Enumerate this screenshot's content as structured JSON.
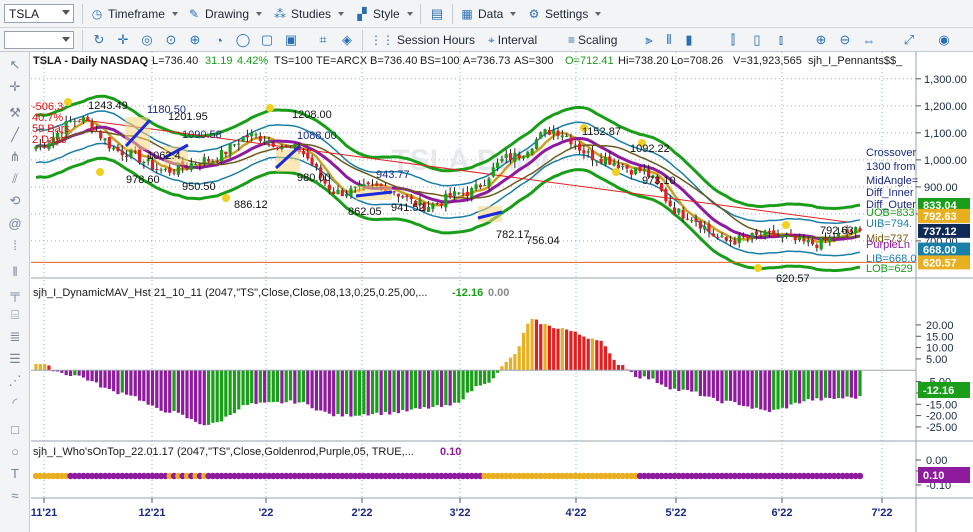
{
  "toolbar": {
    "symbol": "TSLA",
    "timeframe": "Timeframe",
    "drawing": "Drawing",
    "studies": "Studies",
    "style": "Style",
    "data": "Data",
    "settings": "Settings",
    "session_hours": "Session Hours",
    "interval": "Interval",
    "scaling": "Scaling"
  },
  "icons": {
    "timeframe": "clock-icon",
    "drawing": "pencil-icon",
    "studies": "studies-icon",
    "style": "style-icon",
    "data": "data-icon",
    "settings": "gear-icon"
  },
  "price_header": {
    "title": "TSLA - Daily  NASDAQ",
    "L": "L=736.40",
    "chg": "31.19",
    "pct": "4.42%",
    "ts": "TS=100",
    "te": "TE=ARCX",
    "B": "B=736.40",
    "BS": "BS=100",
    "A": "A=736.73",
    "AS": "AS=300",
    "O": "O=712.41",
    "Hi": "Hi=738.20",
    "Lo": "Lo=708.26",
    "V": "V=31,923,565",
    "study": "sjh_I_Pennants$$_"
  },
  "watermark": "TSLA Daily",
  "price_annotations": [
    {
      "text": "-506.3",
      "color": "#e01010"
    },
    {
      "text": "40.7%",
      "color": "#e01010"
    },
    {
      "text": "59 Bars",
      "color": "#e01010"
    },
    {
      "text": "2 Days",
      "color": "#e01010"
    },
    {
      "text": "1243.49",
      "color": "#111111"
    },
    {
      "text": "1180.50",
      "color": "#111111"
    },
    {
      "text": "1201.95",
      "color": "#111111"
    },
    {
      "text": "1090.58",
      "color": "#111111"
    },
    {
      "text": "1062.4",
      "color": "#111111"
    },
    {
      "text": "978.60",
      "color": "#111111"
    },
    {
      "text": "950.50",
      "color": "#111111"
    },
    {
      "text": "886.12",
      "color": "#111111"
    },
    {
      "text": "1208.00",
      "color": "#111111"
    },
    {
      "text": "1088.00",
      "color": "#111111"
    },
    {
      "text": "980.00",
      "color": "#111111"
    },
    {
      "text": "943.77",
      "color": "#111111"
    },
    {
      "text": "862.05",
      "color": "#111111"
    },
    {
      "text": "941.52",
      "color": "#111111"
    },
    {
      "text": "756.04",
      "color": "#111111"
    },
    {
      "text": "782.17",
      "color": "#111111"
    },
    {
      "text": "1152.87",
      "color": "#111111"
    },
    {
      "text": "1092.22",
      "color": "#111111"
    },
    {
      "text": "973.10",
      "color": "#111111"
    },
    {
      "text": "792.63",
      "color": "#111111"
    },
    {
      "text": "620.57",
      "color": "#111111"
    }
  ],
  "side_note": [
    "Crossover",
    "1300 from",
    "MidAngle=",
    "Diff_Inner",
    "Diff_Outer"
  ],
  "band_labels": [
    {
      "text": "UOB=833",
      "color": "#1a9e1a"
    },
    {
      "text": "UIB=794.",
      "color": "#1a7fa8"
    },
    {
      "text": "Mid=737",
      "color": "#7a5a10"
    },
    {
      "text": "PurpleLn",
      "color": "#8e1a9e"
    },
    {
      "text": "LIB=668.0",
      "color": "#1a7fa8"
    },
    {
      "text": "LOB=629",
      "color": "#1a9e1a"
    }
  ],
  "price_axis": {
    "ticks": [
      "1,300.00",
      "1,200.00",
      "1,100.00",
      "1,000.00",
      "900.00",
      "800.00",
      "700.00"
    ],
    "ylim": [
      585,
      1340
    ],
    "badges": [
      {
        "text": "833.04",
        "bg": "#1a9e1a",
        "value": 833.04
      },
      {
        "text": "792.63",
        "bg": "#e8b020",
        "value": 792.63
      },
      {
        "text": "737.12",
        "bg": "#0f2a55",
        "value": 737.12
      },
      {
        "text": "668.00",
        "bg": "#1a7fa8",
        "value": 668.0
      },
      {
        "text": "620.57",
        "bg": "#e8b020",
        "value": 620.57
      }
    ],
    "hline": 620.57
  },
  "sub1": {
    "title": "sjh_I_DynamicMAV_Hst 21_10_11 (2047,\"TS\",Close,Close,08,13,0.25,0.25,00,...",
    "v1": "-12.16",
    "v2": "0.00",
    "ticks": [
      "20.00",
      "15.00",
      "10.00",
      "5.00",
      "-5.00",
      "-10.00",
      "-15.00",
      "-20.00",
      "-25.00"
    ],
    "badge": "-12.16",
    "ylim": [
      -29,
      31
    ]
  },
  "sub2": {
    "title": "sjh_I_Who'sOnTop_22.01.17 (2047,\"TS\",Close,Goldenrod,Purple,05, TRUE,...",
    "v1": "0.10",
    "ticks": [
      "0.00",
      "-0.05",
      "-0.10"
    ],
    "badge": "0.10"
  },
  "time_axis": [
    "11'21",
    "12'21",
    "'22",
    "2'22",
    "3'22",
    "4'22",
    "5'22",
    "6'22",
    "7'22"
  ],
  "chart_data": {
    "type": "candlestick",
    "title": "TSLA - Daily  NASDAQ",
    "x": [
      "11'21",
      "12'21",
      "'22",
      "2'22",
      "3'22",
      "4'22",
      "5'22",
      "6'22",
      "7'22"
    ],
    "ylim": [
      585,
      1340
    ],
    "close_anchor_points": [
      {
        "bar": 0,
        "close": 1050
      },
      {
        "bar": 10,
        "close": 1150
      },
      {
        "bar": 20,
        "close": 1030
      },
      {
        "bar": 30,
        "close": 960
      },
      {
        "bar": 40,
        "close": 1000
      },
      {
        "bar": 50,
        "close": 1090
      },
      {
        "bar": 60,
        "close": 1040
      },
      {
        "bar": 70,
        "close": 880
      },
      {
        "bar": 80,
        "close": 900
      },
      {
        "bar": 90,
        "close": 830
      },
      {
        "bar": 100,
        "close": 880
      },
      {
        "bar": 110,
        "close": 1010
      },
      {
        "bar": 120,
        "close": 1110
      },
      {
        "bar": 130,
        "close": 1010
      },
      {
        "bar": 140,
        "close": 960
      },
      {
        "bar": 150,
        "close": 800
      },
      {
        "bar": 160,
        "close": 700
      },
      {
        "bar": 170,
        "close": 720
      },
      {
        "bar": 180,
        "close": 690
      },
      {
        "bar": 190,
        "close": 736
      }
    ],
    "last": 736.4,
    "histogram_anchor_points": [
      {
        "bar": 0,
        "value": 3
      },
      {
        "bar": 8,
        "value": -2
      },
      {
        "bar": 20,
        "value": -10
      },
      {
        "bar": 30,
        "value": -18
      },
      {
        "bar": 40,
        "value": -24
      },
      {
        "bar": 50,
        "value": -15
      },
      {
        "bar": 60,
        "value": -14
      },
      {
        "bar": 70,
        "value": -20
      },
      {
        "bar": 80,
        "value": -19
      },
      {
        "bar": 95,
        "value": -16
      },
      {
        "bar": 105,
        "value": -5
      },
      {
        "bar": 110,
        "value": 5
      },
      {
        "bar": 115,
        "value": 22
      },
      {
        "bar": 120,
        "value": 19
      },
      {
        "bar": 130,
        "value": 14
      },
      {
        "bar": 135,
        "value": 3
      },
      {
        "bar": 140,
        "value": -3
      },
      {
        "bar": 150,
        "value": -9
      },
      {
        "bar": 160,
        "value": -14
      },
      {
        "bar": 170,
        "value": -18
      },
      {
        "bar": 180,
        "value": -13
      },
      {
        "bar": 190,
        "value": -12
      }
    ],
    "histogram_colors": {
      "pos_up": "#e8b020",
      "pos_down": "#e02020",
      "neg_down": "#8e1a9e",
      "neg_up": "#1a9e1a"
    }
  }
}
